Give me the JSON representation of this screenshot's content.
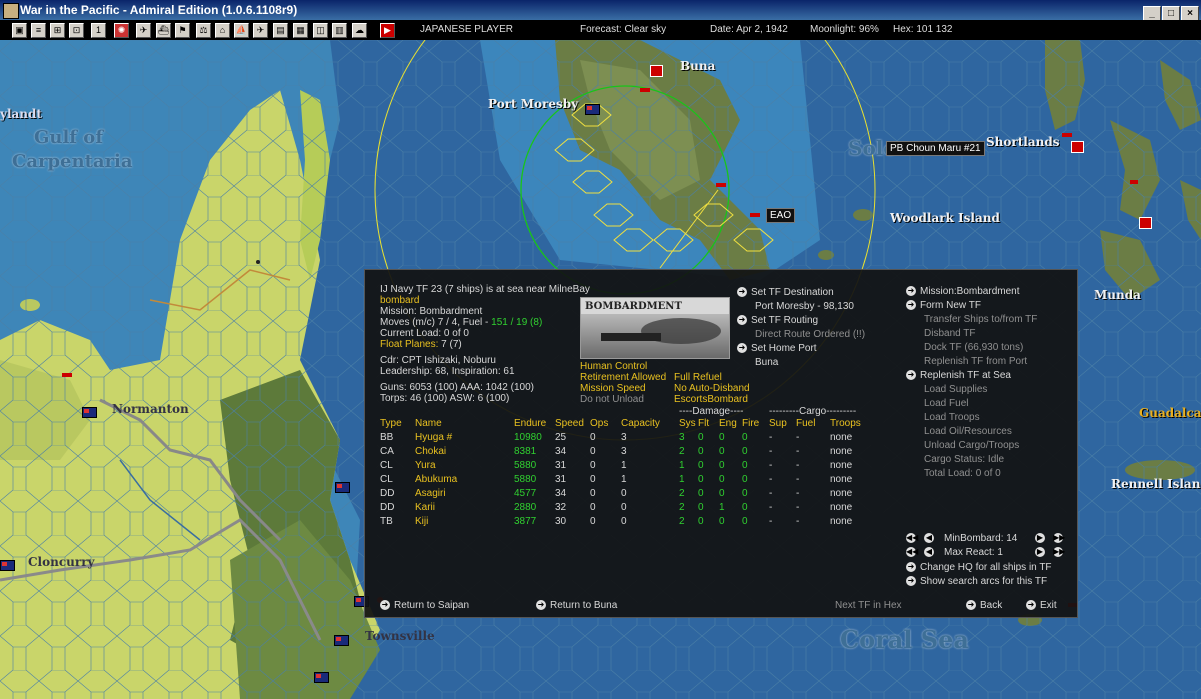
{
  "window": {
    "title": "War in the Pacific - Admiral Edition (1.0.6.1108r9)",
    "buttons": [
      "_",
      "□",
      "×"
    ]
  },
  "status_bar": {
    "player": "JAPANESE PLAYER",
    "forecast": "Forecast: Clear sky",
    "date": "Date: Apr 2, 1942",
    "moonlight": "Moonlight: 96%",
    "hex": "Hex: 101 132"
  },
  "map": {
    "labels": {
      "buna": "Buna",
      "port_moresby": "Port Moresby",
      "shortlands": "Shortlands",
      "woodlark": "Woodlark Island",
      "munda": "Munda",
      "guadalcanal": "Guadalca",
      "rennell": "Rennell Island",
      "normanton": "Normanton",
      "cloncurry": "Cloncurry",
      "townsville": "Townsville",
      "gulf_line1": "Gulf of",
      "gulf_line2": "Carpentaria",
      "ylandt": "ylandt",
      "solo": "Solo",
      "coral_sea": "Coral Sea"
    },
    "tags": {
      "pb_ship": "PB Choun Maru #21",
      "eao": "EAO"
    }
  },
  "tf_panel": {
    "header": "IJ Navy TF 23 (7 ships) is at sea near MilneBay",
    "mission_short": "bombard",
    "mission": "Mission: Bombardment",
    "moves_label": "Moves (m/c) 7 / 4, Fuel - ",
    "fuel_value": "151 / 19 (8)",
    "current_load": "Current Load: 0 of 0",
    "float_planes_label": "Float Planes: ",
    "float_planes_value": "7 (7)",
    "commander": "Cdr: CPT Ishizaki, Noburu",
    "leadership": "Leadership: 68, Inspiration: 61",
    "guns": "Guns: 6053 (100)  AAA: 1042 (100)",
    "torps": "Torps: 46 (100)    ASW: 6 (100)",
    "mission_image_title": "BOMBARDMENT",
    "options": {
      "human_control": "Human Control",
      "retirement": "Retirement Allowed",
      "mission_speed": "Mission Speed",
      "unload": "Do not Unload",
      "full_refuel": "Full Refuel",
      "no_auto_disband": "No Auto-Disband",
      "escorts_bombard": "EscortsBombard"
    },
    "mid_menu": {
      "set_destination": "Set TF Destination",
      "destination_value": "Port Moresby - 98,130",
      "set_routing": "Set TF Routing",
      "routing_value": "Direct Route Ordered (!!)",
      "set_home_port": "Set Home Port",
      "home_port_value": "Buna"
    },
    "right_menu": {
      "mission_bombardment": "Mission:Bombardment",
      "form_new_tf": "Form New TF",
      "transfer_ships": "Transfer Ships to/from TF",
      "disband_tf": "Disband TF",
      "dock_tf": "Dock TF (66,930 tons)",
      "replenish_port": "Replenish TF from Port",
      "replenish_sea": "Replenish TF at Sea",
      "load_supplies": "Load Supplies",
      "load_fuel": "Load Fuel",
      "load_troops": "Load Troops",
      "load_oil": "Load Oil/Resources",
      "unload_cargo": "Unload Cargo/Troops",
      "cargo_status": "Cargo Status: Idle",
      "total_load": "Total Load: 0 of 0"
    },
    "bottom_right": {
      "min_bombard": "MinBombard: 14",
      "max_react": "Max React:  1",
      "change_hq": "Change HQ for all ships in TF",
      "show_search": "Show search arcs for this TF"
    },
    "table": {
      "group_damage": "----Damage----",
      "group_cargo": "---------Cargo---------",
      "headers": [
        "Type",
        "Name",
        "Endure",
        "Speed",
        "Ops",
        "Capacity",
        "Sys",
        "Flt",
        "Eng",
        "Fire",
        "Sup",
        "Fuel",
        "Troops"
      ],
      "rows": [
        [
          "BB",
          "Hyuga #",
          "10980",
          "25",
          "0",
          "3",
          "3",
          "0",
          "0",
          "0",
          "-",
          "-",
          "none"
        ],
        [
          "CA",
          "Chokai",
          "8381",
          "34",
          "0",
          "3",
          "2",
          "0",
          "0",
          "0",
          "-",
          "-",
          "none"
        ],
        [
          "CL",
          "Yura",
          "5880",
          "31",
          "0",
          "1",
          "1",
          "0",
          "0",
          "0",
          "-",
          "-",
          "none"
        ],
        [
          "CL",
          "Abukuma",
          "5880",
          "31",
          "0",
          "1",
          "1",
          "0",
          "0",
          "0",
          "-",
          "-",
          "none"
        ],
        [
          "DD",
          "Asagiri",
          "4577",
          "34",
          "0",
          "0",
          "2",
          "0",
          "0",
          "0",
          "-",
          "-",
          "none"
        ],
        [
          "DD",
          "Karii",
          "2880",
          "32",
          "0",
          "0",
          "2",
          "0",
          "1",
          "0",
          "-",
          "-",
          "none"
        ],
        [
          "TB",
          "Kiji",
          "3877",
          "30",
          "0",
          "0",
          "2",
          "0",
          "0",
          "0",
          "-",
          "-",
          "none"
        ]
      ]
    },
    "footer": {
      "return_saipan": "Return to Saipan",
      "return_buna": "Return to Buna",
      "next_tf": "Next TF in Hex",
      "back": "Back",
      "exit": "Exit"
    }
  }
}
